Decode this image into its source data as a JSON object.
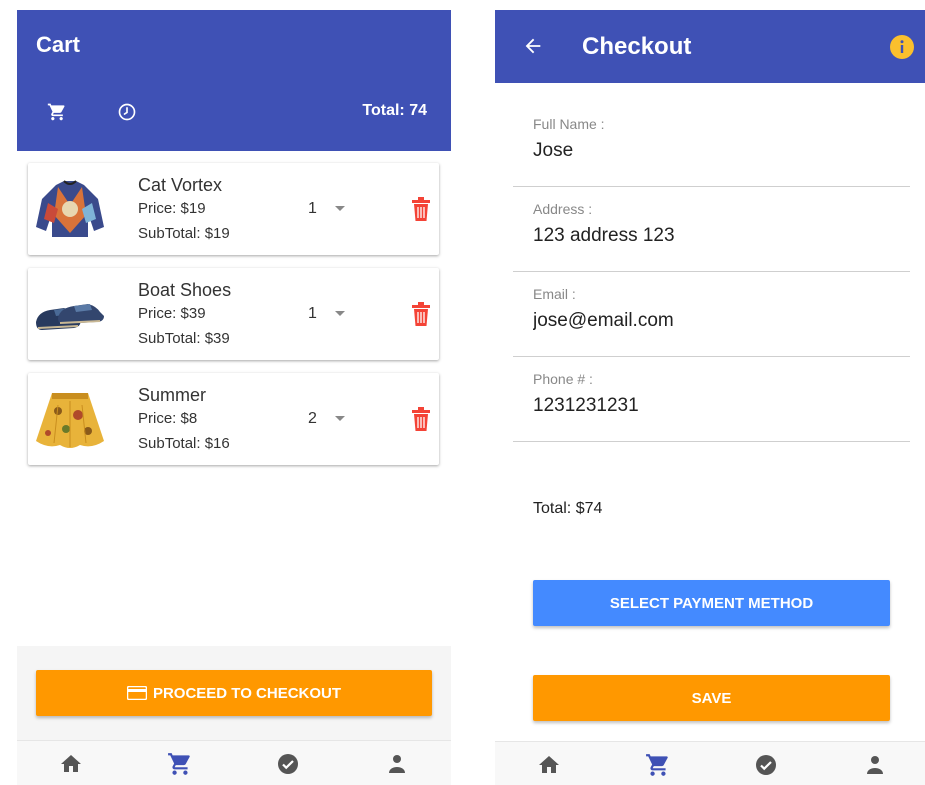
{
  "colors": {
    "primary": "#3f51b5",
    "accent": "#ff9800",
    "payment_button": "#448aff",
    "delete_red": "#f44336",
    "info_yellow": "#fbc02d",
    "nav_active": "#3f51b5",
    "nav_inactive": "#555555"
  },
  "cart": {
    "title": "Cart",
    "header_icons": [
      "cart-icon",
      "clock-icon"
    ],
    "total_label": "Total: 74",
    "items": [
      {
        "name": "Cat Vortex",
        "price": "Price: $19",
        "subtotal": "SubTotal: $19",
        "quantity": "1",
        "image": "sweater-image"
      },
      {
        "name": "Boat Shoes",
        "price": "Price: $39",
        "subtotal": "SubTotal: $39",
        "quantity": "1",
        "image": "shoes-image"
      },
      {
        "name": "Summer",
        "price": "Price: $8",
        "subtotal": "SubTotal: $16",
        "quantity": "2",
        "image": "skirt-image"
      }
    ],
    "checkout_button": "PROCEED TO CHECKOUT"
  },
  "checkout": {
    "title": "Checkout",
    "fields": [
      {
        "label": "Full Name :",
        "value": "Jose"
      },
      {
        "label": "Address :",
        "value": "123 address 123"
      },
      {
        "label": "Email :",
        "value": "jose@email.com"
      },
      {
        "label": "Phone # :",
        "value": "1231231231"
      }
    ],
    "total": "Total: $74",
    "payment_button": "SELECT PAYMENT METHOD",
    "save_button": "SAVE"
  },
  "bottom_nav": {
    "items": [
      "home-icon",
      "cart-icon",
      "check-circle-icon",
      "person-icon"
    ],
    "active": "cart-icon"
  }
}
